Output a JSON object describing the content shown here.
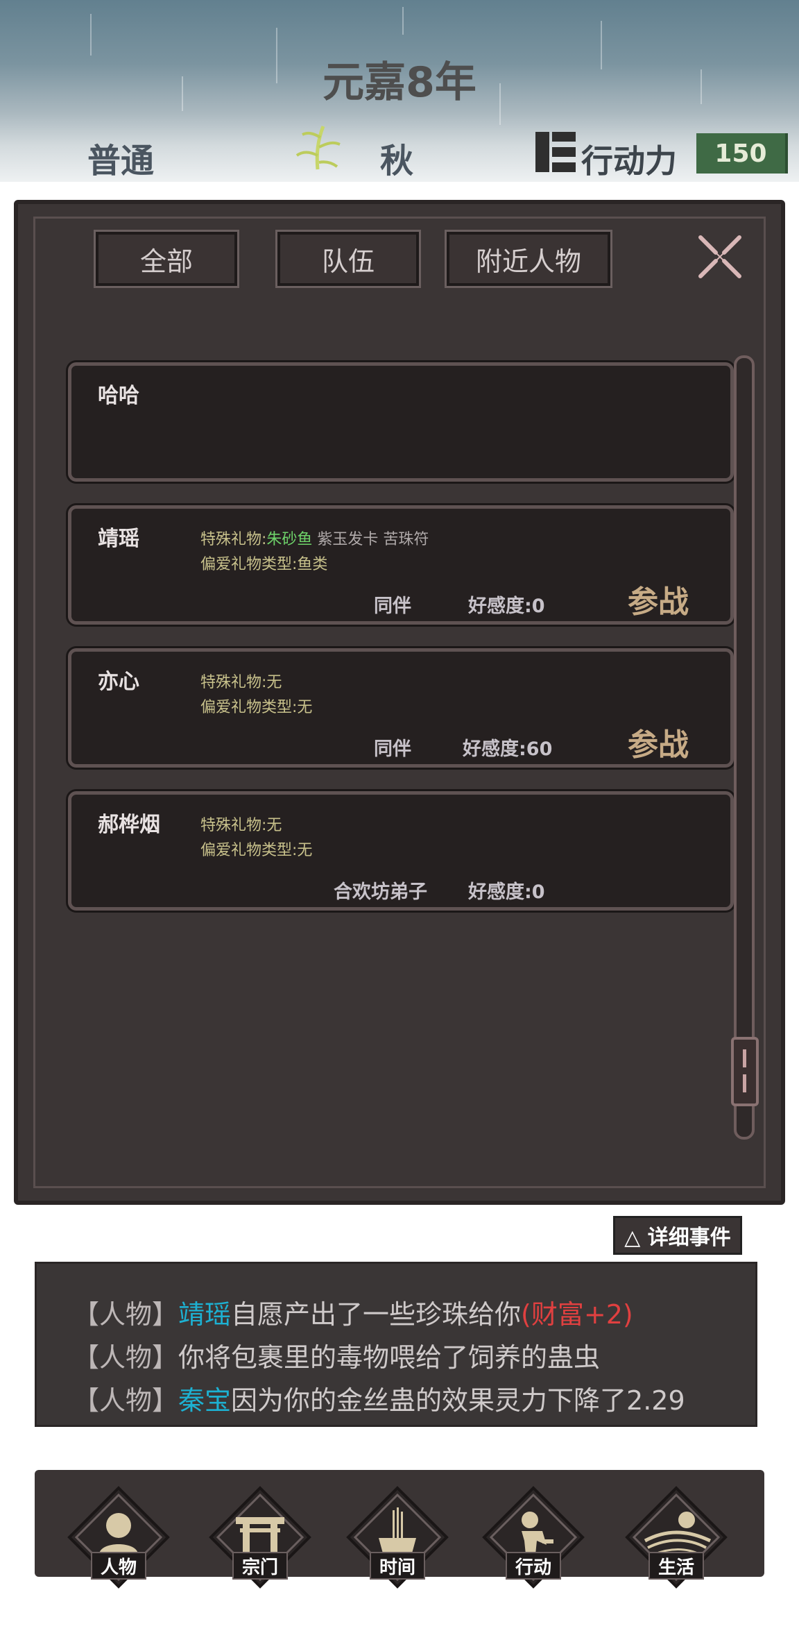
{
  "header": {
    "year": "元嘉8年",
    "difficulty": "普通",
    "season": "秋",
    "action_label": "行动力",
    "action_points": "150",
    "season_icon": "bamboo-icon",
    "action_icon": "action-block-icon"
  },
  "tabs": [
    {
      "label": "全部"
    },
    {
      "label": "队伍"
    },
    {
      "label": "附近人物"
    }
  ],
  "characters": [
    {
      "name": "哈哈"
    },
    {
      "name": "靖瑶",
      "gift_prefix": "特殊礼物:",
      "gift_highlight": "朱砂鱼",
      "gift_rest": " 紫玉发卡 苦珠符",
      "pref": "偏爱礼物类型:鱼类",
      "relation": "同伴",
      "favor": "好感度:0",
      "action": "参战"
    },
    {
      "name": "亦心",
      "gift_prefix": "特殊礼物:无",
      "pref": "偏爱礼物类型:无",
      "relation": "同伴",
      "favor": "好感度:60",
      "action": "参战"
    },
    {
      "name": "郝桦烟",
      "gift_prefix": "特殊礼物:无",
      "pref": "偏爱礼物类型:无",
      "relation": "合欢坊弟子",
      "favor": "好感度:0"
    }
  ],
  "detail_button": "△ 详细事件",
  "log": [
    {
      "tag": "【人物】",
      "name": "靖瑶",
      "text": "自愿产出了一些珍珠给你",
      "effect": "(财富+2)"
    },
    {
      "tag": "【人物】",
      "text": "你将包裹里的毒物喂给了饲养的蛊虫"
    },
    {
      "tag": "【人物】",
      "name": "秦宝",
      "text": "因为你的金丝蛊的效果灵力下降了2.29"
    }
  ],
  "nav": [
    {
      "label": "人物",
      "icon": "person-icon"
    },
    {
      "label": "宗门",
      "icon": "gate-icon"
    },
    {
      "label": "时间",
      "icon": "incense-icon"
    },
    {
      "label": "行动",
      "icon": "action-icon"
    },
    {
      "label": "生活",
      "icon": "landscape-icon"
    }
  ],
  "colors": {
    "panel": "#3b3535",
    "card": "#252020",
    "highlight_green": "#6ed36a",
    "name_cyan": "#1db1d2",
    "effect_red": "#e04040",
    "badge_green": "#3f6a45"
  }
}
